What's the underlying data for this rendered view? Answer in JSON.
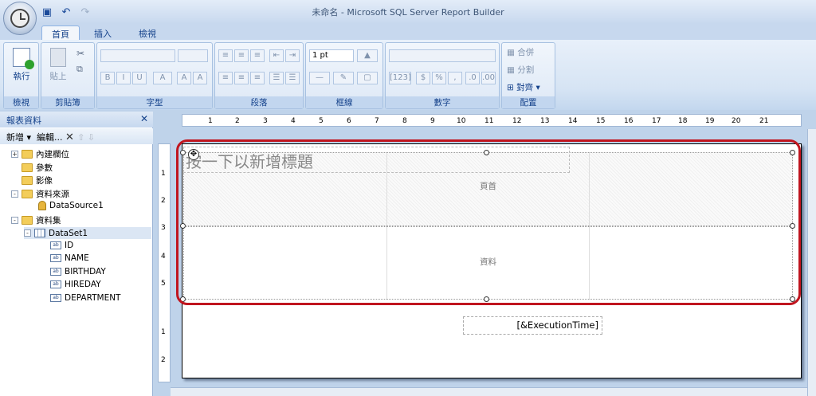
{
  "window": {
    "title": "未命名 - Microsoft SQL Server Report Builder"
  },
  "tabs": [
    {
      "label": "首頁"
    },
    {
      "label": "插入"
    },
    {
      "label": "檢視"
    }
  ],
  "ribbon": {
    "run": {
      "label": "執行",
      "group": "檢視"
    },
    "clipboard": {
      "paste_label": "貼上",
      "group": "剪貼簿"
    },
    "font": {
      "group": "字型"
    },
    "paragraph": {
      "group": "段落"
    },
    "border": {
      "width_value": "1 pt",
      "group": "框線"
    },
    "number": {
      "group": "數字",
      "placeholder_symbol": "[123]"
    },
    "layout": {
      "merge": "合併",
      "split": "分割",
      "align": "對齊",
      "group": "配置"
    }
  },
  "report_data_panel": {
    "title": "報表資料",
    "toolbar": {
      "new": "新增",
      "edit": "編輯..."
    },
    "tree": [
      {
        "label": "內建欄位",
        "type": "folder",
        "expander": "+"
      },
      {
        "label": "參數",
        "type": "folder",
        "expander": ""
      },
      {
        "label": "影像",
        "type": "folder",
        "expander": ""
      },
      {
        "label": "資料來源",
        "type": "folder",
        "expander": "-"
      },
      {
        "label": "DataSource1",
        "type": "datasource"
      },
      {
        "label": "資料集",
        "type": "folder",
        "expander": "-"
      },
      {
        "label": "DataSet1",
        "type": "dataset",
        "expander": "-"
      },
      {
        "label": "ID",
        "type": "field"
      },
      {
        "label": "NAME",
        "type": "field"
      },
      {
        "label": "BIRTHDAY",
        "type": "field"
      },
      {
        "label": "HIREDAY",
        "type": "field"
      },
      {
        "label": "DEPARTMENT",
        "type": "field"
      }
    ]
  },
  "ruler": {
    "h_ticks": [
      "1",
      "2",
      "3",
      "4",
      "5",
      "6",
      "7",
      "8",
      "9",
      "10",
      "11",
      "12",
      "13",
      "14",
      "15",
      "16",
      "17",
      "18",
      "19",
      "20",
      "21"
    ],
    "v_ticks": [
      "1",
      "2",
      "3",
      "4",
      "5",
      "1",
      "2"
    ]
  },
  "report": {
    "title_placeholder": "按一下以新增標題",
    "header_label": "頁首",
    "data_label": "資料",
    "footer_expression": "[&ExecutionTime]"
  },
  "colors": {
    "highlight_frame": "#c0151f"
  }
}
